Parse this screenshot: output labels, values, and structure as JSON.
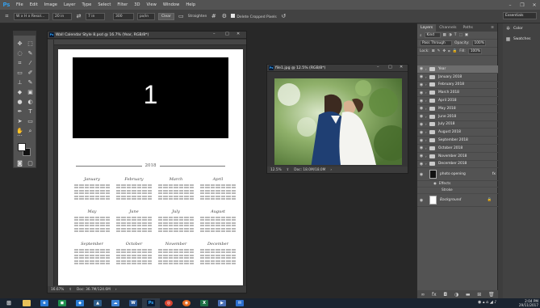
{
  "app": {
    "logo": "Ps"
  },
  "menu": [
    "File",
    "Edit",
    "Image",
    "Layer",
    "Type",
    "Select",
    "Filter",
    "3D",
    "View",
    "Window",
    "Help"
  ],
  "options_bar": {
    "ratio_value": "W x H x Resol...",
    "width_value": "20 in",
    "height_value": "7 in",
    "resolution_value": "300",
    "unit_value": "px/in",
    "clear_label": "Clear",
    "straighten_label": "Straighten",
    "delete_cropped_label": "Delete Cropped Pixels",
    "workspace_label": "Essentials"
  },
  "doc1": {
    "title": "Wall Calendar Style 8.psd @ 16.7% (Year, RGB/8*)",
    "zoom": "16.67%",
    "doc_size": "Doc: 36.7M/124.6M",
    "big_number": "1",
    "year": "2018",
    "months": [
      "January",
      "February",
      "March",
      "April",
      "May",
      "June",
      "July",
      "August",
      "September",
      "October",
      "November",
      "December"
    ]
  },
  "doc2": {
    "title": "file1.jpg @ 12.5% (RGB/8*)",
    "zoom": "12.5%",
    "doc_size": "Doc: 18.0M/18.0M"
  },
  "layers_panel": {
    "tabs": [
      "Layers",
      "Channels",
      "Paths"
    ],
    "kind_label": "Kind",
    "blend_mode": "Pass Through",
    "opacity_label": "Opacity:",
    "opacity_value": "100%",
    "lock_label": "Lock:",
    "fill_label": "Fill:",
    "fill_value": "100%",
    "layers": [
      "Year",
      "January 2018",
      "February 2018",
      "March 2018",
      "April 2018",
      "May 2018",
      "June 2018",
      "July 2018",
      "August 2018",
      "September 2018",
      "October 2018",
      "November 2018",
      "December 2018"
    ],
    "photo_layer": "photo opening",
    "effects_label": "Effects",
    "stroke_label": "Stroke",
    "background_layer": "Background"
  },
  "mini_panel": {
    "color_label": "Color",
    "swatches_label": "Swatches"
  },
  "clock": {
    "time": "2:04 PM",
    "date": "29/11/2017"
  }
}
